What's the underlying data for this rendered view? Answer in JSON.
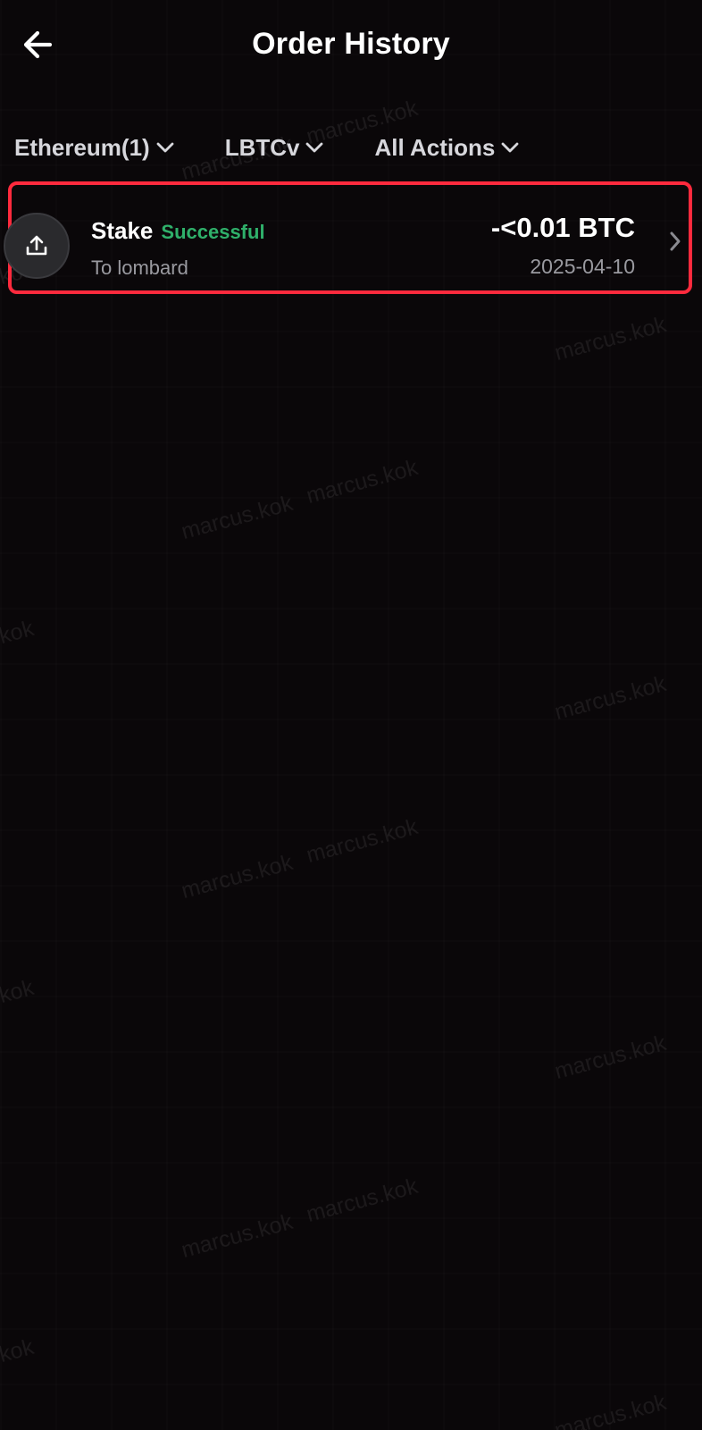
{
  "header": {
    "title": "Order History",
    "back_icon": "arrow-left-icon"
  },
  "filters": [
    {
      "label": "Ethereum(1)",
      "icon": "chevron-down-icon"
    },
    {
      "label": "LBTCv",
      "icon": "chevron-down-icon"
    },
    {
      "label": "All Actions",
      "icon": "chevron-down-icon"
    }
  ],
  "orders": [
    {
      "icon": "upload-icon",
      "action": "Stake",
      "status": "Successful",
      "subtitle": "To lombard",
      "amount": "-<0.01 BTC",
      "date": "2025-04-10"
    }
  ],
  "watermark": {
    "text": "marcus.kok"
  },
  "colors": {
    "background": "#0a0709",
    "text_primary": "#ffffff",
    "text_secondary": "#9a9aa0",
    "status_success": "#2fb06a",
    "highlight_border": "#ff2a3d"
  }
}
